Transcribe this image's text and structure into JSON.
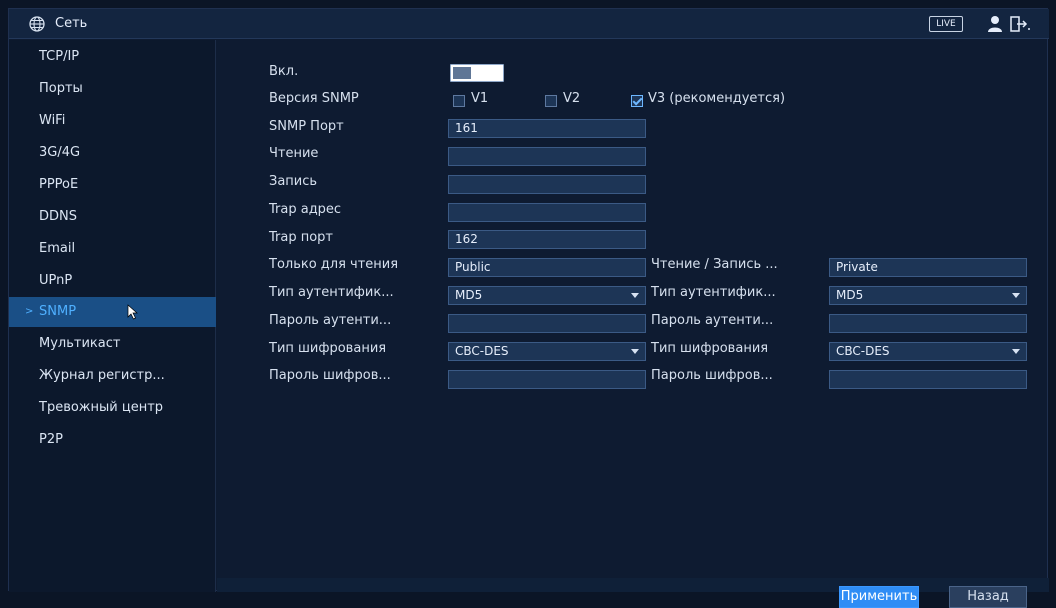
{
  "header": {
    "icon": "globe-icon",
    "title": "Сеть",
    "live_label": "LIVE",
    "user_icon": "user-icon",
    "logout_icon": "logout-icon"
  },
  "sidebar": {
    "items": [
      {
        "label": "TCP/IP"
      },
      {
        "label": "Порты"
      },
      {
        "label": "WiFi"
      },
      {
        "label": "3G/4G"
      },
      {
        "label": "PPPoE"
      },
      {
        "label": "DDNS"
      },
      {
        "label": "Email"
      },
      {
        "label": "UPnP"
      },
      {
        "label": "SNMP",
        "active": true
      },
      {
        "label": "Мультикаст"
      },
      {
        "label": "Журнал регистр..."
      },
      {
        "label": "Тревожный центр"
      },
      {
        "label": "P2P"
      }
    ],
    "active_arrow": ">"
  },
  "form": {
    "enable_label": "Вкл.",
    "enable_on": false,
    "version_label": "Версия SNMP",
    "v1_label": "V1",
    "v1_checked": false,
    "v2_label": "V2",
    "v2_checked": false,
    "v3_label": "V3 (рекомендуется)",
    "v3_checked": true,
    "snmp_port_label": "SNMP Порт",
    "snmp_port_value": "161",
    "read_label": "Чтение",
    "read_value": "",
    "write_label": "Запись",
    "write_value": "",
    "trap_addr_label": "Trap адрес",
    "trap_addr_value": "",
    "trap_port_label": "Trap порт",
    "trap_port_value": "162",
    "left": {
      "ro_label": "Только для чтения",
      "ro_value": "Public",
      "auth_type_label": "Тип аутентифик...",
      "auth_type_value": "MD5",
      "auth_pass_label": "Пароль аутенти...",
      "auth_pass_value": "",
      "enc_type_label": "Тип шифрования",
      "enc_type_value": "CBC-DES",
      "enc_pass_label": "Пароль шифров...",
      "enc_pass_value": ""
    },
    "right": {
      "rw_label": "Чтение / Запись ...",
      "rw_value": "Private",
      "auth_type_label": "Тип аутентифик...",
      "auth_type_value": "MD5",
      "auth_pass_label": "Пароль аутенти...",
      "auth_pass_value": "",
      "enc_type_label": "Тип шифрования",
      "enc_type_value": "CBC-DES",
      "enc_pass_label": "Пароль шифров...",
      "enc_pass_value": ""
    }
  },
  "buttons": {
    "apply": "Применить",
    "back": "Назад"
  },
  "colors": {
    "accent": "#2f8df5",
    "active_nav": "#1a4f86",
    "background": "#0e1b31"
  }
}
